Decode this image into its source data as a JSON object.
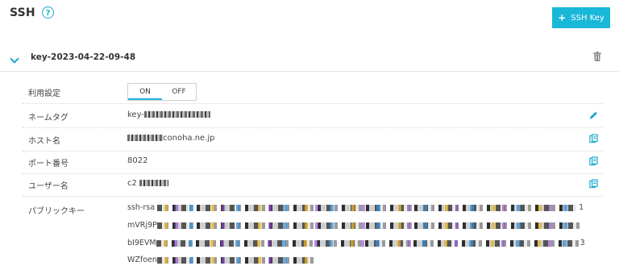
{
  "page": {
    "title": "SSH",
    "help_icon": "?"
  },
  "toolbar": {
    "add_label": "SSH Key",
    "add_icon": "+"
  },
  "key": {
    "name": "key-2023-04-22-09-48",
    "fields": {
      "usage_label": "利用設定",
      "toggle_on": "ON",
      "toggle_off": "OFF",
      "toggle_selected": "ON",
      "nametag_label": "ネームタグ",
      "nametag_prefix": "key-",
      "host_label": "ホスト名",
      "host_suffix": "conoha.ne.jp",
      "port_label": "ポート番号",
      "port_value": "8022",
      "user_label": "ユーザー名",
      "user_prefix": "c2",
      "pubkey_label": "パブリックキー",
      "pubkey_lines": [
        {
          "prefix": "ssh-rsa",
          "suffix": "1"
        },
        {
          "prefix": "mVRj9P",
          "suffix": ""
        },
        {
          "prefix": "bI9EVM",
          "suffix": "3"
        },
        {
          "prefix": "WZfoen",
          "suffix": ""
        }
      ]
    }
  },
  "colors": {
    "accent": "#19b7d8",
    "text": "#333333",
    "divider": "#e3e3e3"
  }
}
